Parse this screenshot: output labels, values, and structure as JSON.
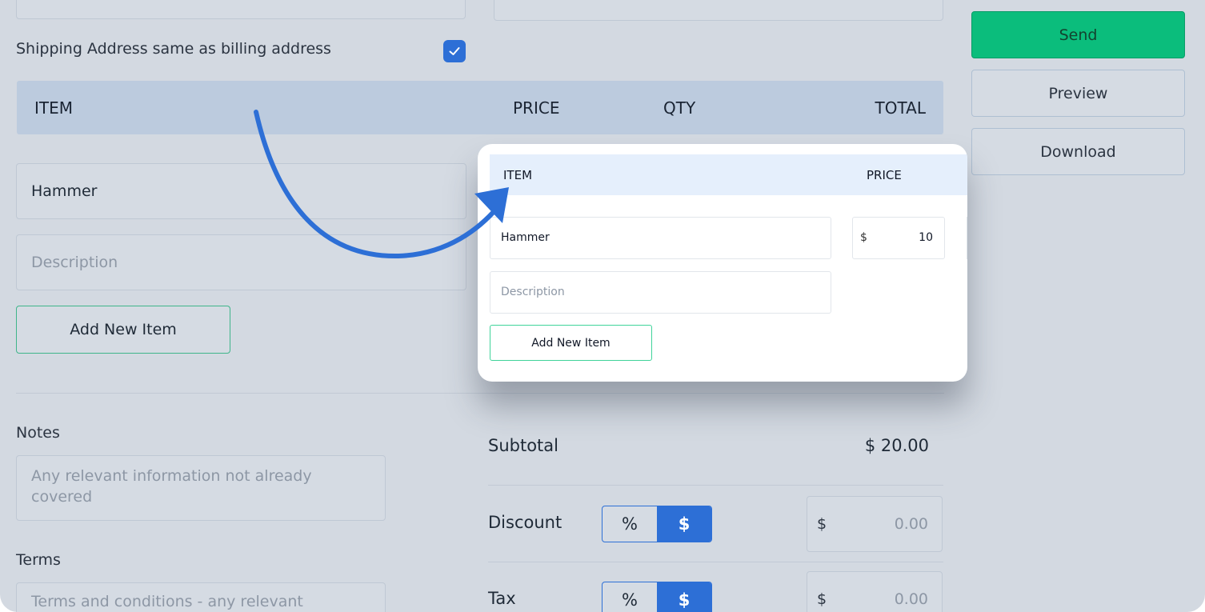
{
  "form": {
    "shipping_same_label": "Shipping Address same as billing address",
    "shipping_same_checked": true,
    "table_headers": {
      "item": "ITEM",
      "price": "PRICE",
      "qty": "QTY",
      "total": "TOTAL"
    },
    "item": {
      "name": "Hammer",
      "description_placeholder": "Description"
    },
    "add_item_label": "Add New Item",
    "notes": {
      "label": "Notes",
      "placeholder": "Any relevant information not already covered"
    },
    "terms": {
      "label": "Terms",
      "placeholder": "Terms and conditions - any relevant"
    }
  },
  "totals": {
    "subtotal_label": "Subtotal",
    "subtotal_value": "$ 20.00",
    "discount_label": "Discount",
    "tax_label": "Tax",
    "toggle_percent": "%",
    "toggle_dollar": "$",
    "currency_symbol": "$",
    "discount_value": "0.00",
    "tax_value": "0.00"
  },
  "actions": {
    "send": "Send",
    "preview": "Preview",
    "download": "Download"
  },
  "callout": {
    "header_item": "ITEM",
    "header_price": "PRICE",
    "item_name": "Hammer",
    "price_currency": "$",
    "price_value": "10",
    "description_placeholder": "Description",
    "add_item_label": "Add New Item"
  },
  "colors": {
    "accent_blue": "#2d6fd6",
    "send_green": "#0bbd7c",
    "header_bg": "#bccbde",
    "page_bg": "#d3d9e1"
  }
}
